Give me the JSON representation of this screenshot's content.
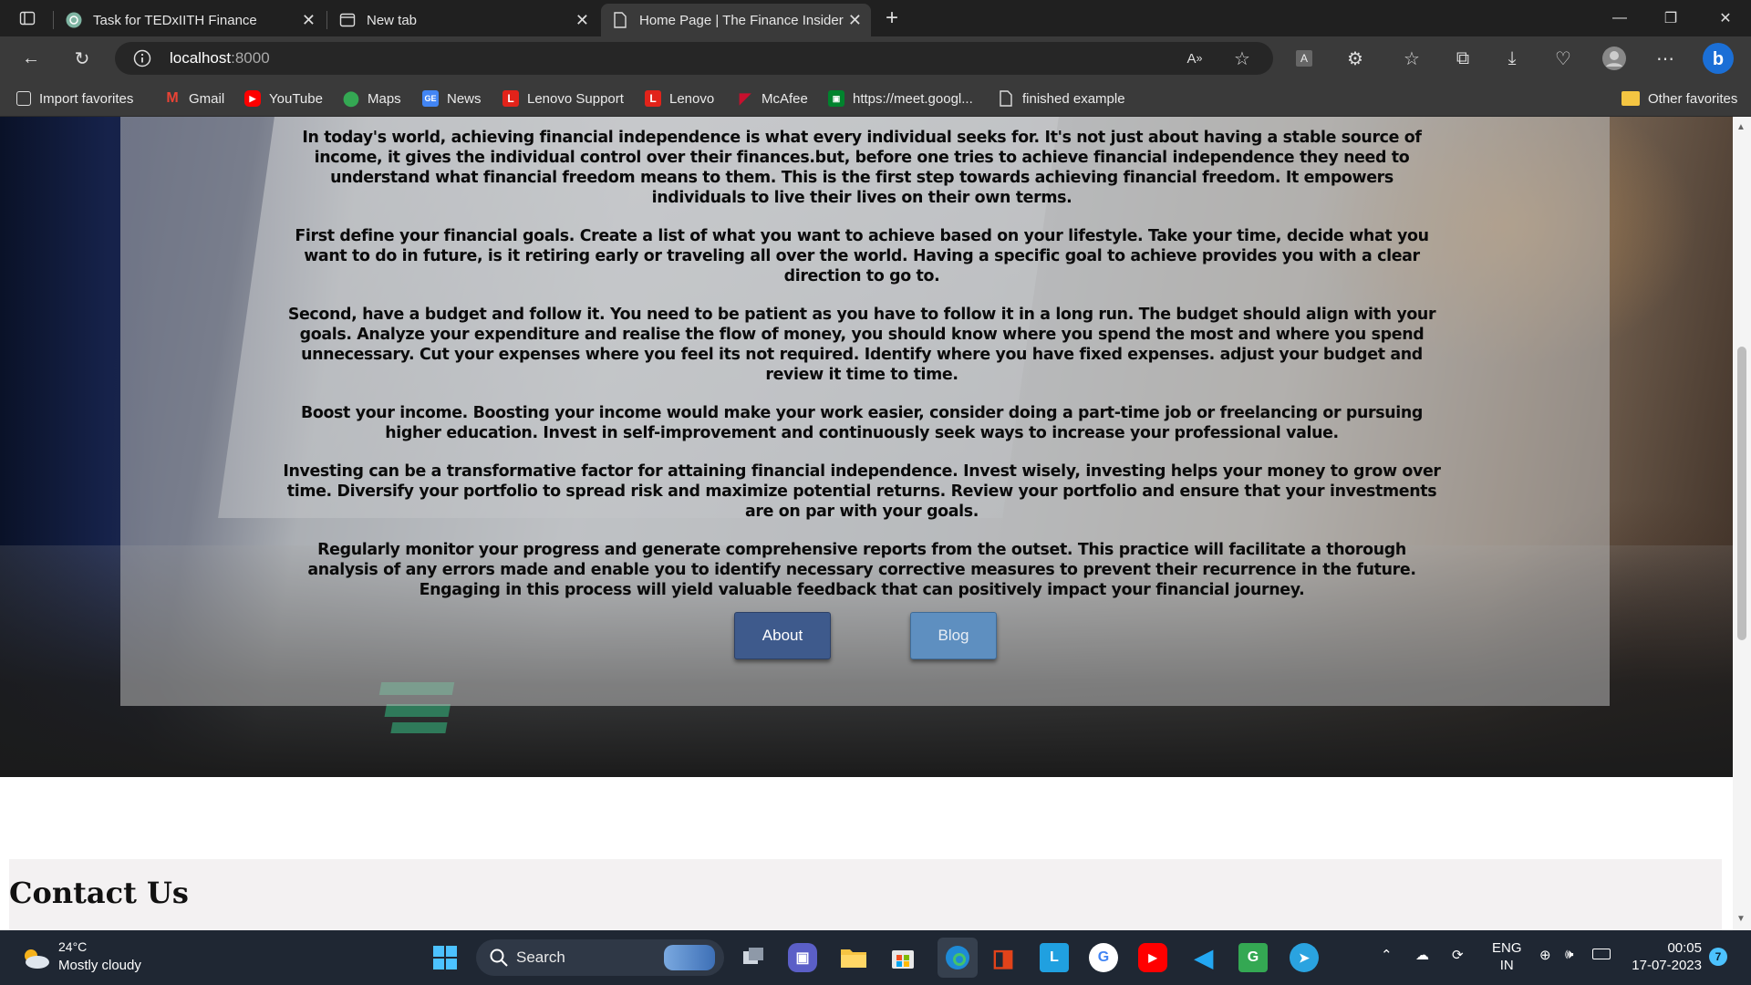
{
  "tabs": [
    {
      "title": "Task for TEDxIITH Finance",
      "active": false
    },
    {
      "title": "New tab",
      "active": false
    },
    {
      "title": "Home Page | The Finance Insider",
      "active": true
    }
  ],
  "address": {
    "host": "localhost",
    "port": ":8000"
  },
  "bookmarks": [
    {
      "label": "Import favorites",
      "icon": "import-icon"
    },
    {
      "label": "Gmail",
      "icon": "gmail-icon"
    },
    {
      "label": "YouTube",
      "icon": "youtube-icon"
    },
    {
      "label": "Maps",
      "icon": "maps-icon"
    },
    {
      "label": "News",
      "icon": "news-icon"
    },
    {
      "label": "Lenovo Support",
      "icon": "lenovo-icon"
    },
    {
      "label": "Lenovo",
      "icon": "lenovo-icon"
    },
    {
      "label": "McAfee",
      "icon": "mcafee-icon"
    },
    {
      "label": "https://meet.googl...",
      "icon": "meet-icon"
    },
    {
      "label": "finished example",
      "icon": "page-icon"
    }
  ],
  "other_favorites": "Other favorites",
  "article": {
    "paragraphs": [
      "In today's world, achieving financial independence is what every individual seeks for. It's not just about having a stable source of income, it gives the individual control over their finances.but, before one tries to achieve financial independence they need to understand what financial freedom means to them. This is the first step towards achieving financial freedom. It empowers individuals to live their lives on their own terms.",
      "First define your financial goals. Create a list of what you want to achieve based on your lifestyle. Take your time, decide what you want to do in future, is it retiring early or traveling all over the world. Having a specific goal to achieve provides you with a clear direction to go to.",
      "Second, have a budget and follow it. You need to be patient as you have to follow it in a long run. The budget should align with your goals. Analyze your expenditure and realise the flow of money, you should know where you spend the most and where you spend unnecessary. Cut your expenses where you feel its not required. Identify where you have fixed expenses. adjust your budget and review it time to time.",
      "Boost your income. Boosting your income would make your work easier, consider doing a part-time job or freelancing or pursuing higher education. Invest in self-improvement and continuously seek ways to increase your professional value.",
      "Investing can be a transformative factor for attaining financial independence. Invest wisely, investing helps your money to grow over time. Diversify your portfolio to spread risk and maximize potential returns. Review your portfolio and ensure that your investments are on par with your goals.",
      "Regularly monitor your progress and generate comprehensive reports from the outset. This practice will facilitate a thorough analysis of any errors made and enable you to identify necessary corrective measures to prevent their recurrence in the future. Engaging in this process will yield valuable feedback that can positively impact your financial journey."
    ]
  },
  "buttons": {
    "about": "About",
    "blog": "Blog"
  },
  "contact": {
    "title": "Contact Us"
  },
  "taskbar": {
    "weather_temp": "24°C",
    "weather_desc": "Mostly cloudy",
    "search": "Search",
    "lang_1": "ENG",
    "lang_2": "IN",
    "time": "00:05",
    "date": "17-07-2023",
    "notifications": "7"
  },
  "colors": {
    "about_button": "#3e5a8c",
    "blog_button": "#5e8fc0",
    "taskbar": "#1f2733"
  }
}
